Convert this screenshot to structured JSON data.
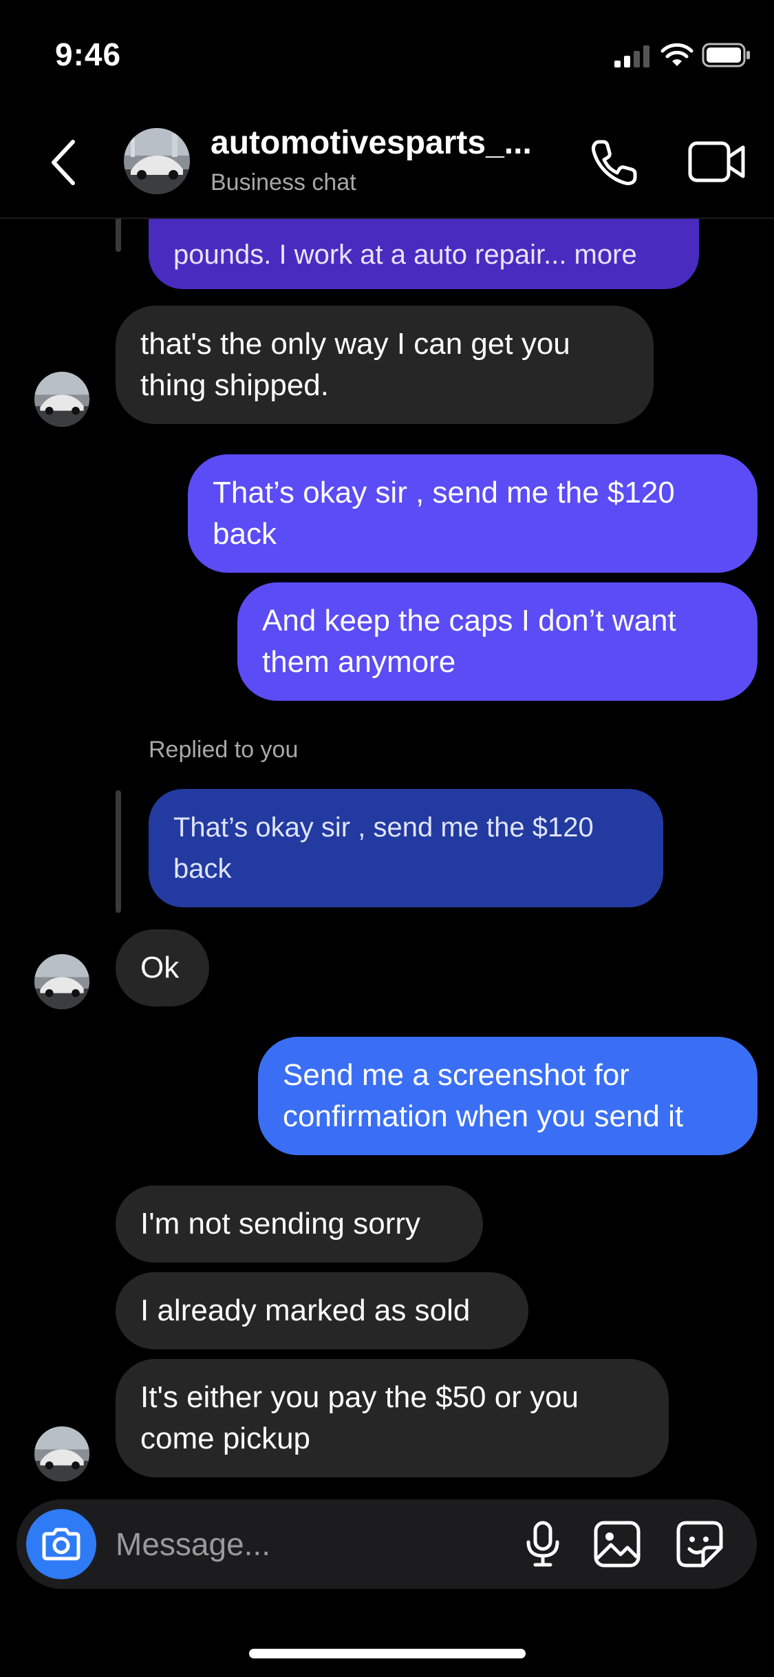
{
  "status_bar": {
    "time": "9:46"
  },
  "header": {
    "title": "automotivesparts_...",
    "subtitle": "Business chat"
  },
  "messages": [
    {
      "from": "me",
      "kind": "quoted",
      "text": "pounds. I work at a auto repair... more"
    },
    {
      "from": "them",
      "text": "that's the only way I can get you\nthing shipped."
    },
    {
      "from": "me",
      "text": "That’s okay sir , send me the $120\nback"
    },
    {
      "from": "me",
      "text": "And keep the caps I don’t want\nthem anymore"
    },
    {
      "from": "them",
      "kind": "reply_label",
      "text": "Replied to you"
    },
    {
      "from": "them",
      "kind": "quoted",
      "text": "That’s okay sir , send me the $120\nback"
    },
    {
      "from": "them",
      "text": "Ok"
    },
    {
      "from": "me",
      "text": "Send me a screenshot for\nconfirmation when you send it"
    },
    {
      "from": "them",
      "text": "I'm not sending sorry"
    },
    {
      "from": "them",
      "text": "I already marked as sold"
    },
    {
      "from": "them",
      "text": "It's either you pay the $50 or you\ncome pickup"
    }
  ],
  "composer": {
    "placeholder": "Message..."
  },
  "colors": {
    "background": "#000000",
    "incoming_bubble": "#262626",
    "outgoing_purple": "#5b4cf5",
    "outgoing_blue": "#3a6ff5",
    "camera_button": "#2f7bf6"
  },
  "icons": [
    "chevron-left-icon",
    "phone-icon",
    "video-camera-icon",
    "camera-icon",
    "microphone-icon",
    "gallery-icon",
    "sticker-icon"
  ]
}
